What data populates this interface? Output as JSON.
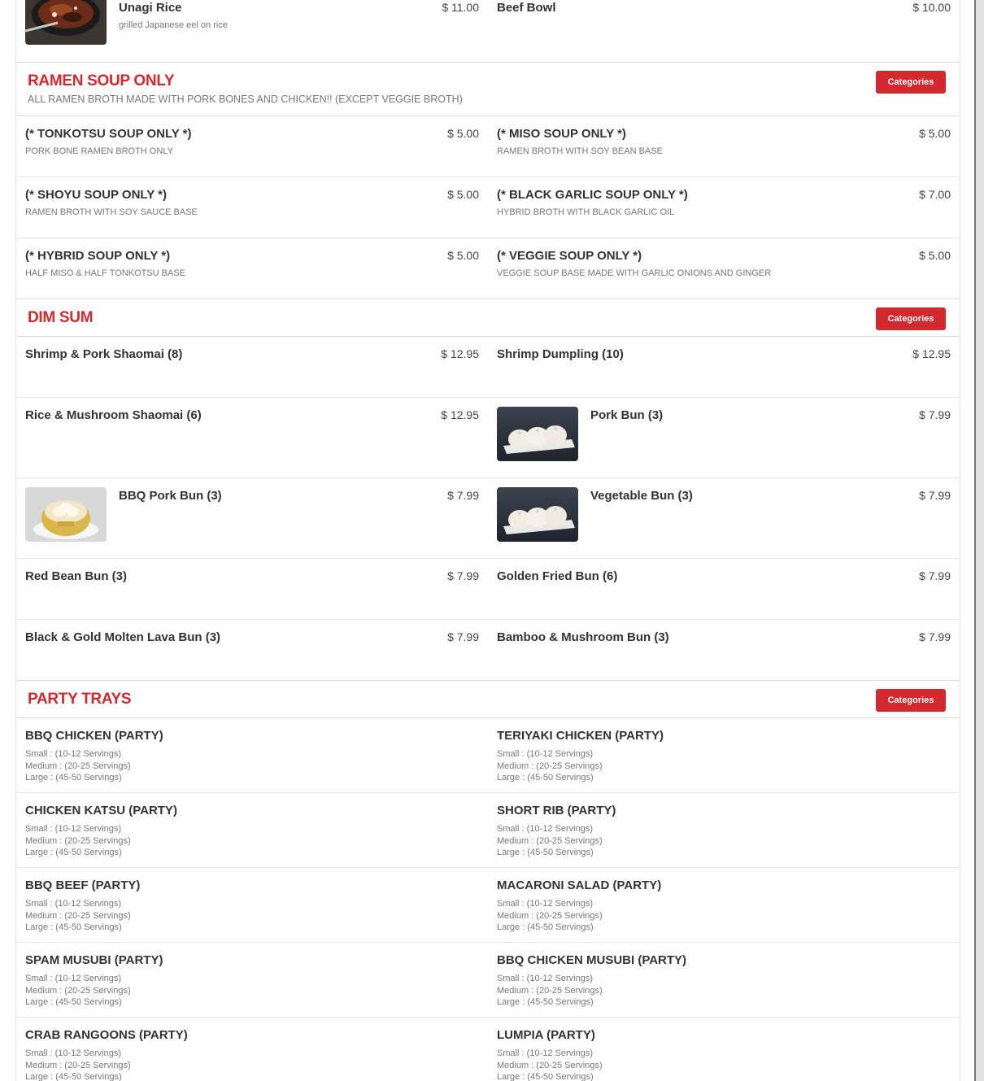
{
  "top_row": {
    "left": {
      "name": "Unagi Rice",
      "price": "$ 11.00",
      "desc": "grilled Japanese eel on rice"
    },
    "right": {
      "name": "Beef Bowl",
      "price": "$ 10.00"
    }
  },
  "ramen": {
    "title": "RAMEN SOUP ONLY",
    "subtitle": "ALL RAMEN BROTH MADE WITH PORK BONES AND CHICKEN!! (EXCEPT VEGGIE BROTH)",
    "button": "Categories",
    "rows": [
      [
        {
          "name": "(* TONKOTSU SOUP ONLY *)",
          "price": "$ 5.00",
          "desc": "PORK BONE RAMEN BROTH ONLY"
        },
        {
          "name": "(* MISO SOUP ONLY *)",
          "price": "$ 5.00",
          "desc": "RAMEN BROTH WITH SOY BEAN BASE"
        }
      ],
      [
        {
          "name": "(* SHOYU SOUP ONLY *)",
          "price": "$ 5.00",
          "desc": "RAMEN BROTH WITH SOY SAUCE BASE"
        },
        {
          "name": "(* BLACK GARLIC SOUP ONLY *)",
          "price": "$ 7.00",
          "desc": "HYBRID BROTH WITH BLACK GARLIC OIL"
        }
      ],
      [
        {
          "name": "(* HYBRID SOUP ONLY *)",
          "price": "$ 5.00",
          "desc": "HALF MISO & HALF TONKOTSU BASE"
        },
        {
          "name": "(* VEGGIE SOUP ONLY *)",
          "price": "$ 5.00",
          "desc": "VEGGIE SOUP BASE MADE WITH GARLIC ONIONS AND GINGER"
        }
      ]
    ]
  },
  "dimsum": {
    "title": "DIM SUM",
    "button": "Categories",
    "rows": [
      [
        {
          "name": "Shrimp & Pork Shaomai (8)",
          "price": "$ 12.95"
        },
        {
          "name": "Shrimp Dumpling (10)",
          "price": "$ 12.95"
        }
      ],
      [
        {
          "name": "Rice & Mushroom Shaomai (6)",
          "price": "$ 12.95"
        },
        {
          "name": "Pork Bun (3)",
          "price": "$ 7.99",
          "image": "steamed-buns-photo"
        }
      ],
      [
        {
          "name": "BBQ Pork Bun (3)",
          "price": "$ 7.99",
          "image": "bbq-bun-steamer-photo"
        },
        {
          "name": "Vegetable Bun (3)",
          "price": "$ 7.99",
          "image": "steamed-buns-photo"
        }
      ],
      [
        {
          "name": "Red Bean Bun (3)",
          "price": "$ 7.99"
        },
        {
          "name": "Golden Fried Bun (6)",
          "price": "$ 7.99"
        }
      ],
      [
        {
          "name": "Black & Gold Molten Lava Bun (3)",
          "price": "$ 7.99"
        },
        {
          "name": "Bamboo & Mushroom Bun (3)",
          "price": "$ 7.99"
        }
      ]
    ]
  },
  "party": {
    "title": "PARTY TRAYS",
    "button": "Categories",
    "sizes": {
      "small": "Small : (10-12 Servings)",
      "medium": "Medium : (20-25 Servings)",
      "large": "Large : (45-50 Servings)"
    },
    "rows": [
      [
        {
          "name": "BBQ CHICKEN (PARTY)"
        },
        {
          "name": "TERIYAKI CHICKEN (PARTY)"
        }
      ],
      [
        {
          "name": "CHICKEN KATSU (PARTY)"
        },
        {
          "name": "SHORT RIB (PARTY)"
        }
      ],
      [
        {
          "name": "BBQ BEEF (PARTY)"
        },
        {
          "name": "MACARONI SALAD (PARTY)"
        }
      ],
      [
        {
          "name": "SPAM MUSUBI (PARTY)"
        },
        {
          "name": "BBQ CHICKEN MUSUBI (PARTY)"
        }
      ],
      [
        {
          "name": "CRAB RANGOONS (PARTY)"
        },
        {
          "name": "LUMPIA (PARTY)"
        }
      ]
    ]
  },
  "colors": {
    "accent": "#d3282d",
    "text": "#333333",
    "muted": "#777777"
  }
}
